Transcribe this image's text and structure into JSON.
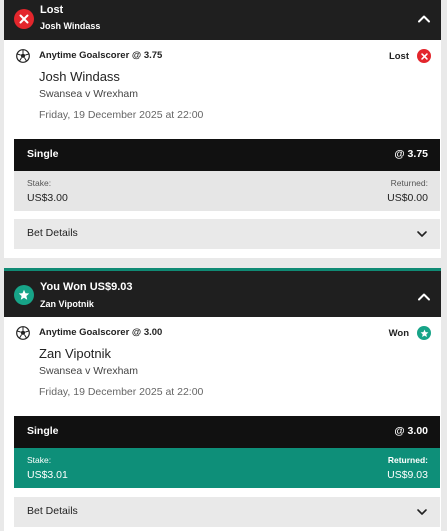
{
  "bets": [
    {
      "header_title": "Lost",
      "header_subtitle": "Josh Windass",
      "status_icon": "close-icon",
      "market": "Anytime Goalscorer @ 3.75",
      "leg_status": "Lost",
      "player": "Josh Windass",
      "event": "Swansea v Wrexham",
      "date": "Friday, 19 December 2025 at 22:00",
      "bet_type": "Single",
      "odds": "@ 3.75",
      "stake_label": "Stake:",
      "stake": "US$3.00",
      "returned_label": "Returned:",
      "returned": "US$0.00",
      "details_label": "Bet Details"
    },
    {
      "header_title": "You Won US$9.03",
      "header_subtitle": "Zan Vipotnik",
      "status_icon": "star-icon",
      "market": "Anytime Goalscorer @ 3.00",
      "leg_status": "Won",
      "player": "Zan Vipotnik",
      "event": "Swansea v Wrexham",
      "date": "Friday, 19 December 2025 at 22:00",
      "bet_type": "Single",
      "odds": "@ 3.00",
      "stake_label": "Stake:",
      "stake": "US$3.01",
      "returned_label": "Returned:",
      "returned": "US$9.03",
      "details_label": "Bet Details"
    }
  ],
  "colors": {
    "lost": "#e3262c",
    "won": "#17a488",
    "won_bar": "#0e8f79",
    "header": "#1f1f1f"
  }
}
